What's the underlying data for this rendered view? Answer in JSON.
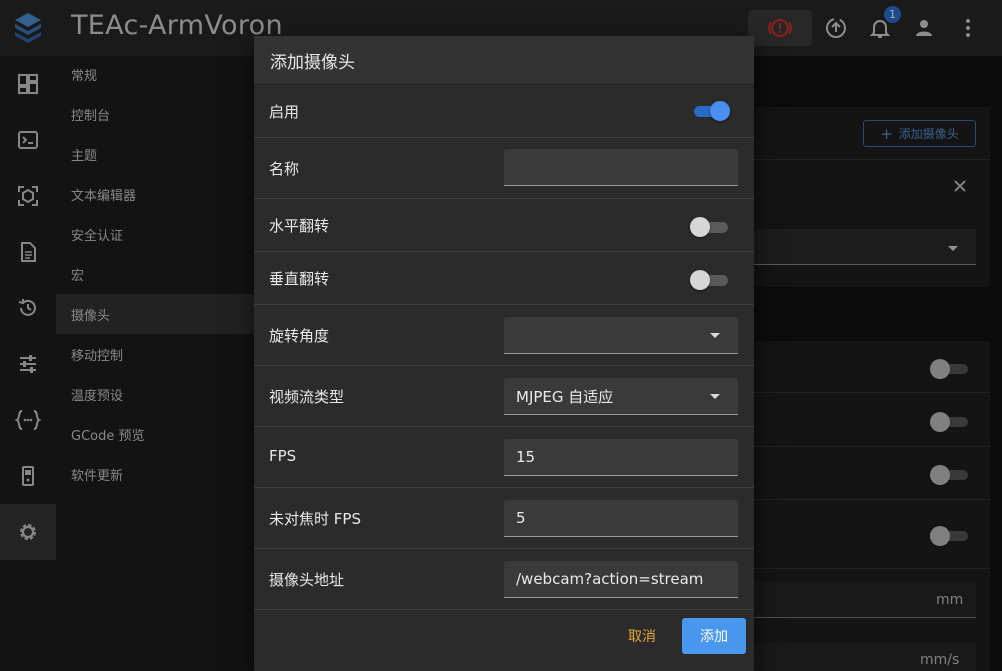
{
  "app": {
    "title": "TEAc-ArmVoron",
    "notification_count": "1"
  },
  "nav": {
    "items": [
      "常规",
      "控制台",
      "主题",
      "文本编辑器",
      "安全认证",
      "宏",
      "摄像头",
      "移动控制",
      "温度预设",
      "GCode 预览",
      "软件更新"
    ],
    "active_index": 6
  },
  "background": {
    "add_camera_label": "添加摄像头",
    "unit_mm": "mm",
    "unit_mms": "mm/s"
  },
  "dialog": {
    "title": "添加摄像头",
    "enabled": {
      "label": "启用",
      "value": true
    },
    "name": {
      "label": "名称",
      "value": ""
    },
    "flip_horizontal": {
      "label": "水平翻转",
      "value": false
    },
    "flip_vertical": {
      "label": "垂直翻转",
      "value": false
    },
    "rotation": {
      "label": "旋转角度",
      "value": ""
    },
    "stream_type": {
      "label": "视频流类型",
      "value": "MJPEG 自适应"
    },
    "fps": {
      "label": "FPS",
      "value": "15"
    },
    "fps_idle": {
      "label": "未对焦时 FPS",
      "value": "5"
    },
    "url": {
      "label": "摄像头地址",
      "value": "/webcam?action=stream"
    },
    "cancel_label": "取消",
    "add_label": "添加"
  },
  "colors": {
    "accent": "#4a97f0",
    "cancel": "#e4a53b",
    "estop": "#d32f2f"
  }
}
